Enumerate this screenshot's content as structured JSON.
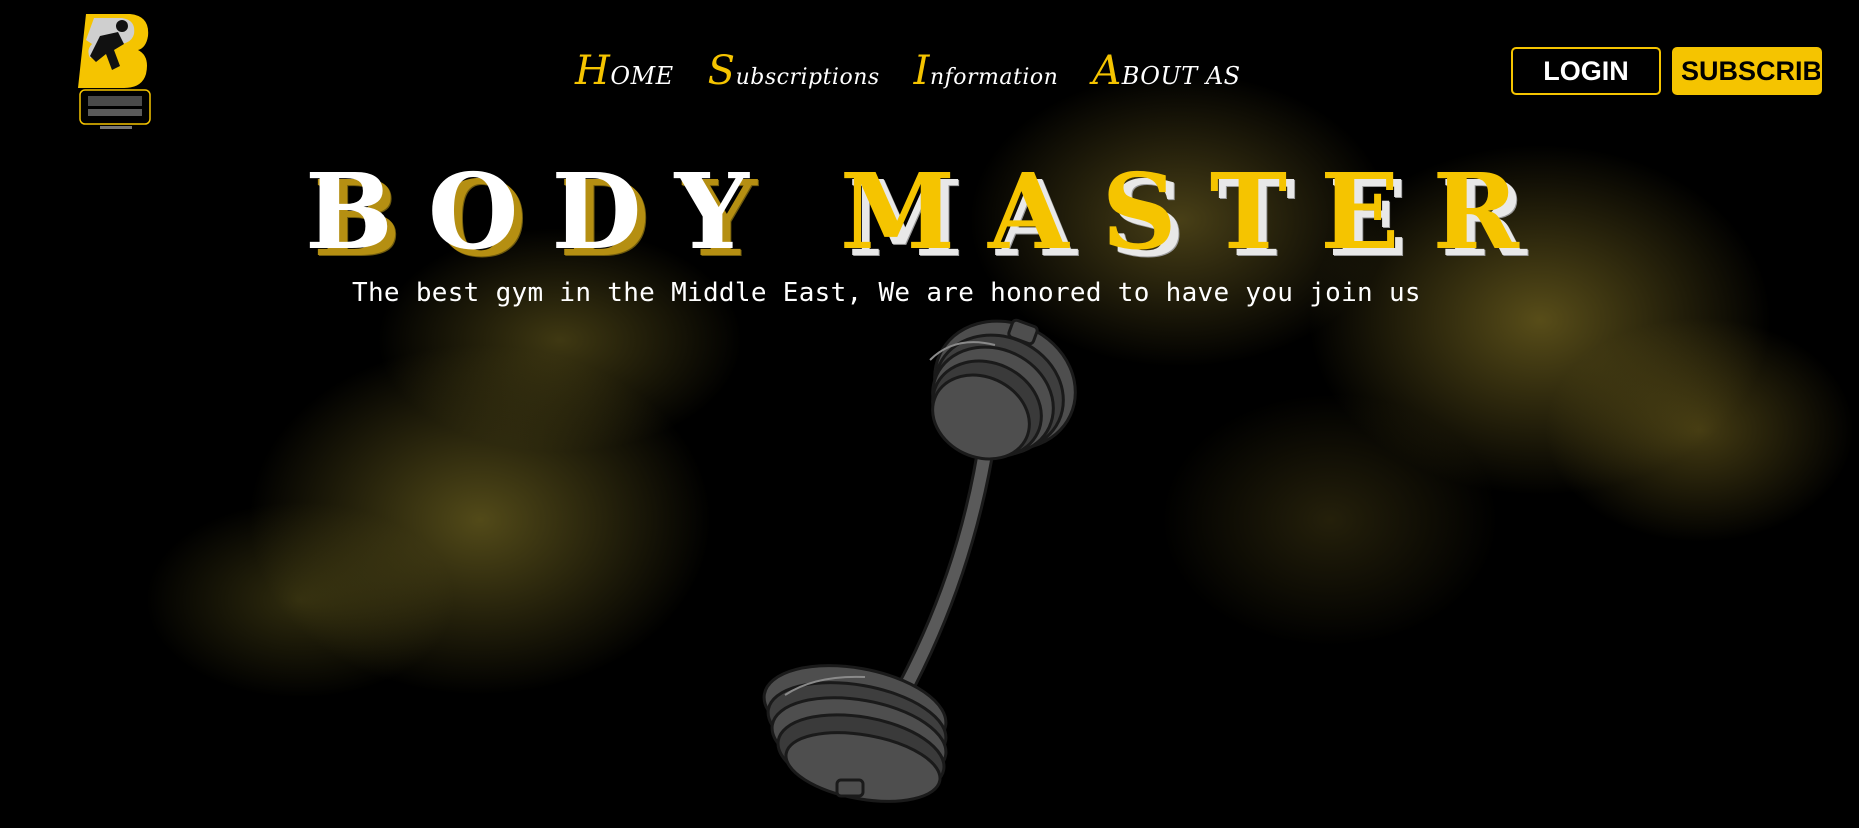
{
  "nav": {
    "items": [
      {
        "initial": "H",
        "rest": "OME"
      },
      {
        "initial": "S",
        "rest": "ubscriptions"
      },
      {
        "initial": "I",
        "rest": "nformation"
      },
      {
        "initial": "A",
        "rest": "BOUT AS"
      }
    ]
  },
  "header": {
    "login_label": "LOGIN",
    "subscribe_label": "SUBSCRIB"
  },
  "hero": {
    "title_part1": "BODY",
    "title_part2": "MASTER",
    "subtitle": "The best gym in the Middle East, We are honored to have you join us"
  },
  "icons": {
    "logo": "runner-logo-icon",
    "barbell": "barbell-icon"
  },
  "colors": {
    "accent": "#f5c400",
    "background": "#000000",
    "smoke": "#9a8a2e"
  }
}
